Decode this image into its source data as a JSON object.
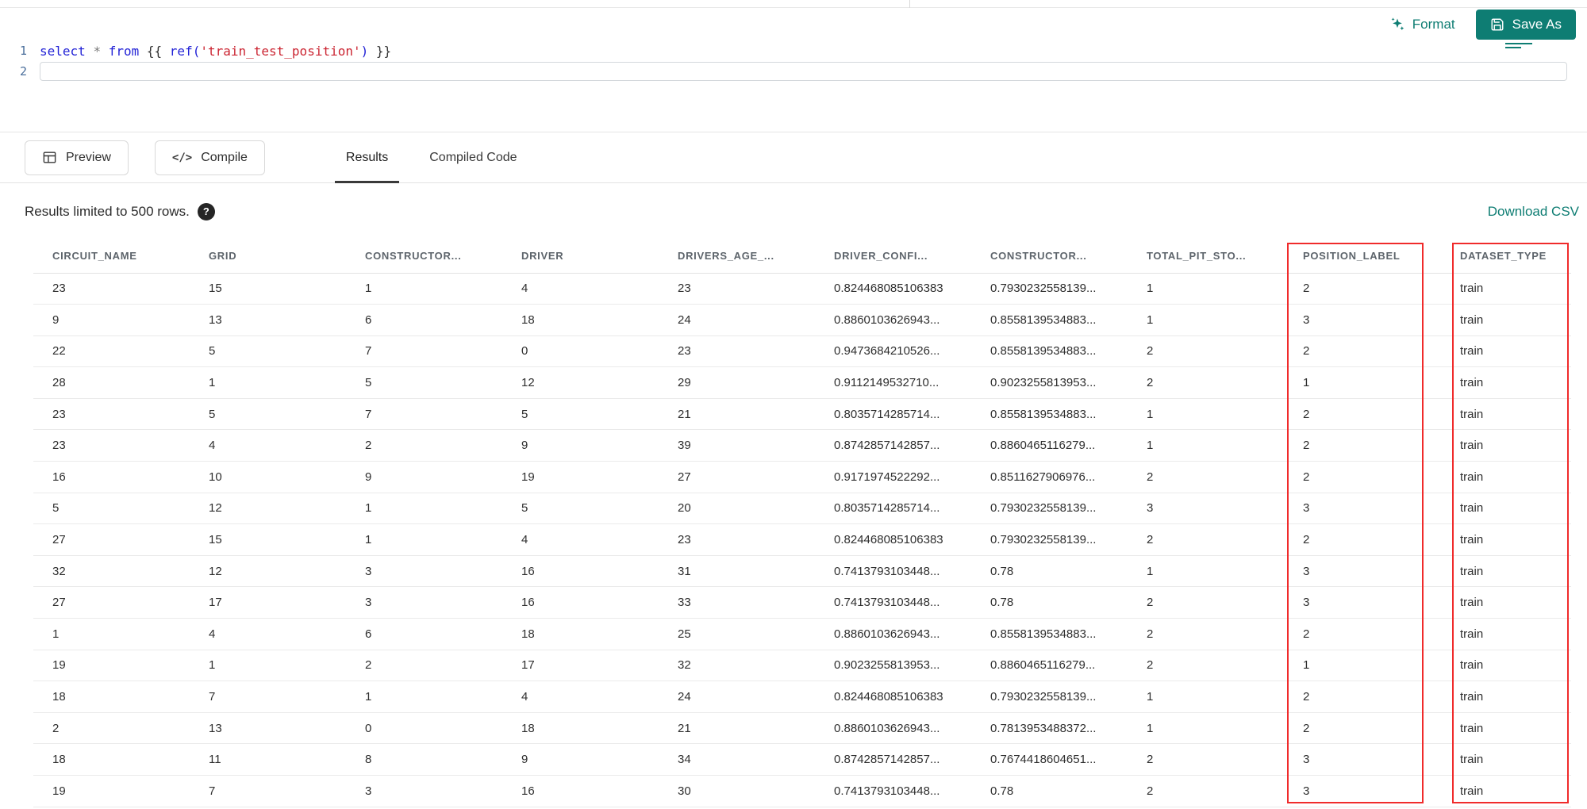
{
  "editor": {
    "line_numbers": [
      "1",
      "2"
    ],
    "code_text": "select * from {{ ref('train_test_position') }}",
    "tokens": [
      {
        "t": "select",
        "c": "kw"
      },
      {
        "t": " ",
        "c": "brace"
      },
      {
        "t": "*",
        "c": "op"
      },
      {
        "t": " ",
        "c": "brace"
      },
      {
        "t": "from",
        "c": "kw"
      },
      {
        "t": " ",
        "c": "brace"
      },
      {
        "t": "{{ ",
        "c": "brace"
      },
      {
        "t": "ref(",
        "c": "fn"
      },
      {
        "t": "'train_test_position'",
        "c": "str"
      },
      {
        "t": ")",
        "c": "fn"
      },
      {
        "t": " }}",
        "c": "brace"
      }
    ]
  },
  "toolbar": {
    "format_label": "Format",
    "save_as_label": "Save As"
  },
  "actions": {
    "preview_label": "Preview",
    "compile_label": "Compile",
    "compile_icon_glyph": "</>"
  },
  "tabs": [
    {
      "label": "Results",
      "active": true
    },
    {
      "label": "Compiled Code",
      "active": false
    }
  ],
  "results_meta": {
    "limit_text": "Results limited to 500 rows.",
    "help_glyph": "?",
    "download_label": "Download CSV"
  },
  "table": {
    "columns": [
      "CIRCUIT_NAME",
      "GRID",
      "CONSTRUCTOR...",
      "DRIVER",
      "DRIVERS_AGE_...",
      "DRIVER_CONFI...",
      "CONSTRUCTOR...",
      "TOTAL_PIT_STO...",
      "POSITION_LABEL",
      "DATASET_TYPE"
    ],
    "highlighted_columns": [
      "POSITION_LABEL",
      "DATASET_TYPE"
    ],
    "rows": [
      [
        "23",
        "15",
        "1",
        "4",
        "23",
        "0.824468085106383",
        "0.7930232558139...",
        "1",
        "2",
        "train"
      ],
      [
        "9",
        "13",
        "6",
        "18",
        "24",
        "0.8860103626943...",
        "0.8558139534883...",
        "1",
        "3",
        "train"
      ],
      [
        "22",
        "5",
        "7",
        "0",
        "23",
        "0.9473684210526...",
        "0.8558139534883...",
        "2",
        "2",
        "train"
      ],
      [
        "28",
        "1",
        "5",
        "12",
        "29",
        "0.9112149532710...",
        "0.9023255813953...",
        "2",
        "1",
        "train"
      ],
      [
        "23",
        "5",
        "7",
        "5",
        "21",
        "0.8035714285714...",
        "0.8558139534883...",
        "1",
        "2",
        "train"
      ],
      [
        "23",
        "4",
        "2",
        "9",
        "39",
        "0.8742857142857...",
        "0.8860465116279...",
        "1",
        "2",
        "train"
      ],
      [
        "16",
        "10",
        "9",
        "19",
        "27",
        "0.9171974522292...",
        "0.8511627906976...",
        "2",
        "2",
        "train"
      ],
      [
        "5",
        "12",
        "1",
        "5",
        "20",
        "0.8035714285714...",
        "0.7930232558139...",
        "3",
        "3",
        "train"
      ],
      [
        "27",
        "15",
        "1",
        "4",
        "23",
        "0.824468085106383",
        "0.7930232558139...",
        "2",
        "2",
        "train"
      ],
      [
        "32",
        "12",
        "3",
        "16",
        "31",
        "0.7413793103448...",
        "0.78",
        "1",
        "3",
        "train"
      ],
      [
        "27",
        "17",
        "3",
        "16",
        "33",
        "0.7413793103448...",
        "0.78",
        "2",
        "3",
        "train"
      ],
      [
        "1",
        "4",
        "6",
        "18",
        "25",
        "0.8860103626943...",
        "0.8558139534883...",
        "2",
        "2",
        "train"
      ],
      [
        "19",
        "1",
        "2",
        "17",
        "32",
        "0.9023255813953...",
        "0.8860465116279...",
        "2",
        "1",
        "train"
      ],
      [
        "18",
        "7",
        "1",
        "4",
        "24",
        "0.824468085106383",
        "0.7930232558139...",
        "1",
        "2",
        "train"
      ],
      [
        "2",
        "13",
        "0",
        "18",
        "21",
        "0.8860103626943...",
        "0.7813953488372...",
        "1",
        "2",
        "train"
      ],
      [
        "18",
        "11",
        "8",
        "9",
        "34",
        "0.8742857142857...",
        "0.7674418604651...",
        "2",
        "3",
        "train"
      ],
      [
        "19",
        "7",
        "3",
        "16",
        "30",
        "0.7413793103448...",
        "0.78",
        "2",
        "3",
        "train"
      ]
    ]
  },
  "colors": {
    "accent_teal": "#0E7D73",
    "highlight_red": "#F02B2B",
    "keyword_blue": "#2222D6",
    "string_red": "#CB2431"
  }
}
